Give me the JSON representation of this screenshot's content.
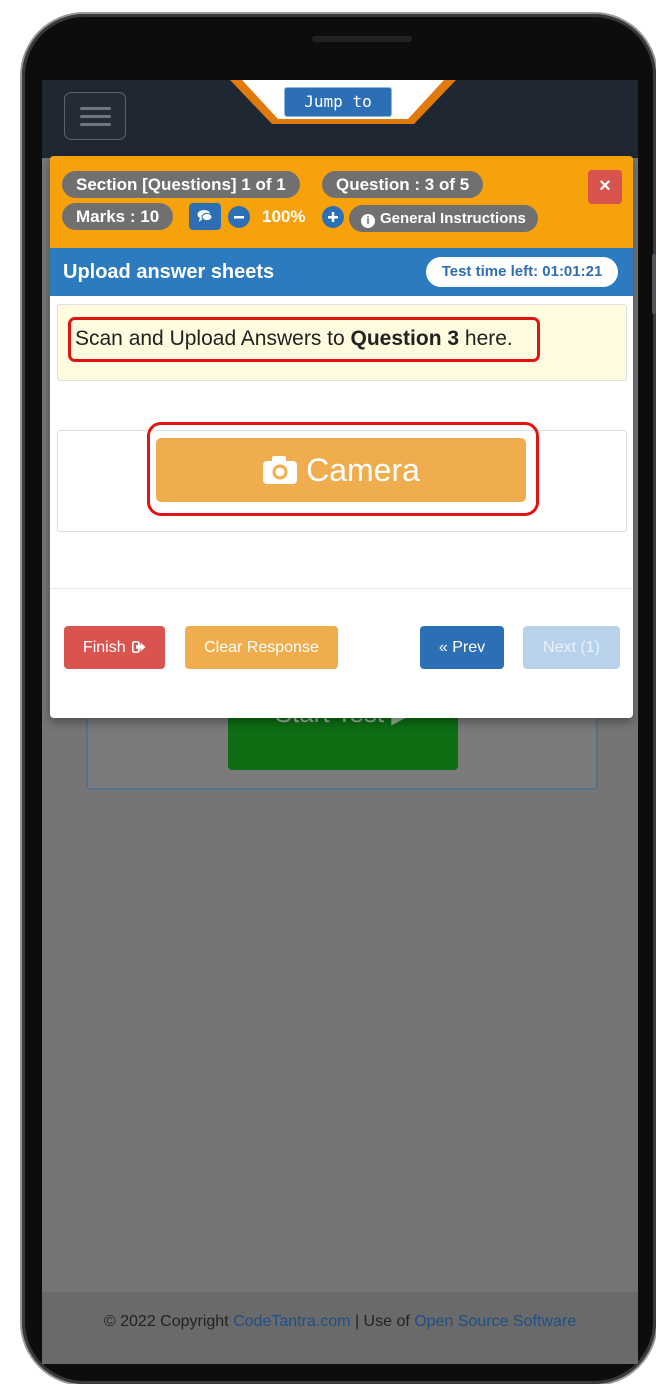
{
  "navbar": {
    "jump_to_label": "Jump to"
  },
  "header": {
    "section_label": "Section [Questions] 1 of 1",
    "question_label": "Question : 3 of 5",
    "marks_label": "Marks : 10",
    "zoom_level": "100%",
    "general_instructions_label": "General Instructions",
    "close_label": "×"
  },
  "title_bar": {
    "title": "Upload answer sheets",
    "timer_label": "Test time left: 01:01:21"
  },
  "question": {
    "prefix": "Scan and Upload Answers to",
    "bold_part": "Question 3",
    "suffix": "here."
  },
  "camera": {
    "label": "Camera"
  },
  "footer_buttons": {
    "finish_label": "Finish",
    "clear_label": "Clear Response",
    "prev_label": "« Prev",
    "next_label": "Next (1)"
  },
  "background_page": {
    "start_test_label": "Start Test"
  },
  "footer": {
    "copyright_text": "© 2022 Copyright",
    "company_link": "CodeTantra.com",
    "separator_text": "| Use of",
    "oss_link": "Open Source Software"
  },
  "colors": {
    "header_orange": "#f8a20b",
    "title_blue": "#2d7bbf",
    "camera_orange": "#efad4d",
    "finish_red": "#d9534f",
    "highlight_red": "#e11414"
  }
}
